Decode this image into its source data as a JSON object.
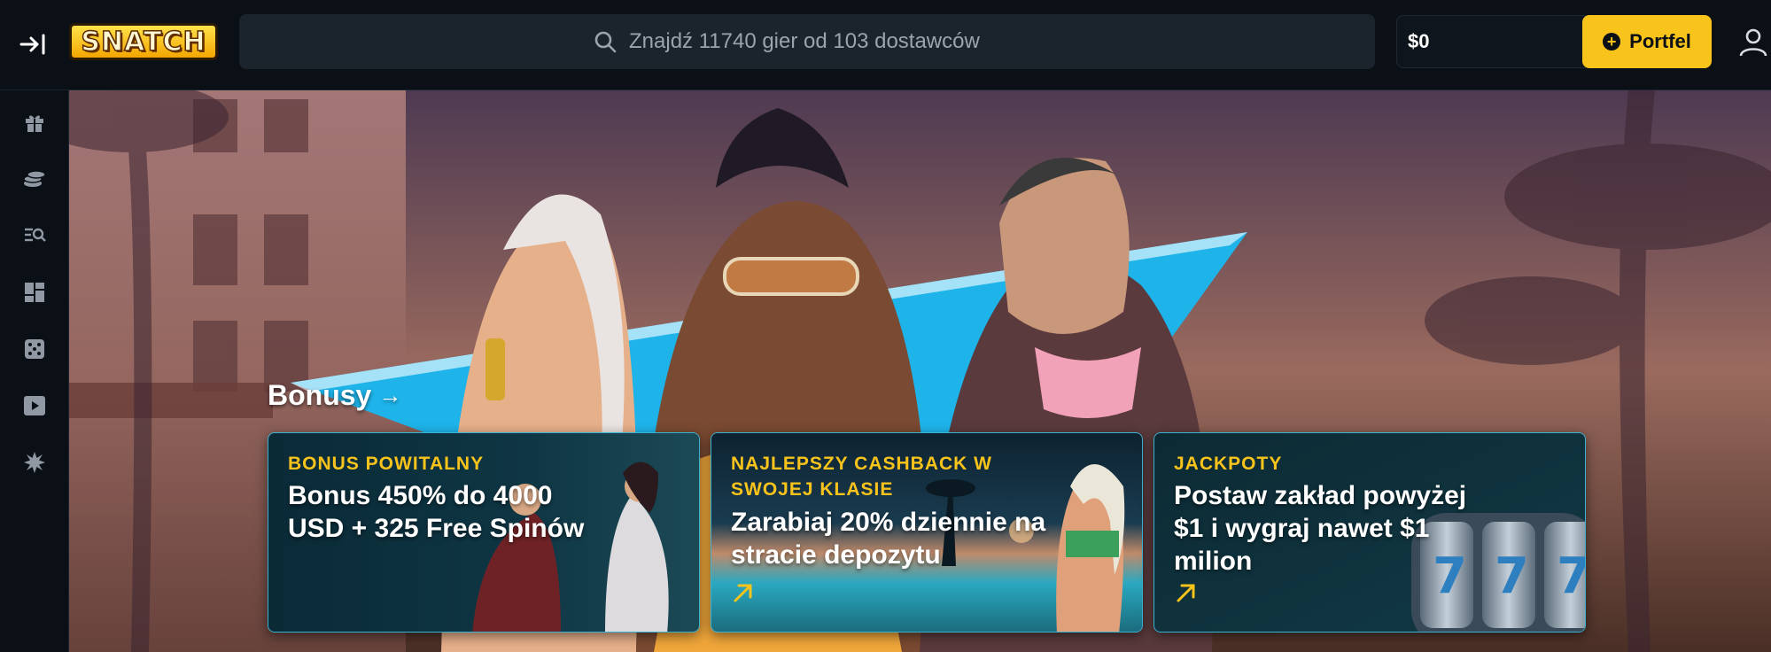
{
  "header": {
    "logo_text": "SNATCH",
    "search_placeholder": "Znajdź 11740 gier od 103 dostawców",
    "balance": "$0",
    "wallet_label": "Portfel"
  },
  "sidebar": {
    "items": [
      {
        "icon": "gift-icon"
      },
      {
        "icon": "coins-icon"
      },
      {
        "icon": "search-list-icon"
      },
      {
        "icon": "dashboard-icon"
      },
      {
        "icon": "dice-icon"
      },
      {
        "icon": "play-icon"
      },
      {
        "icon": "burst-icon"
      }
    ]
  },
  "hero": {
    "section_title": "Bonusy",
    "cards": [
      {
        "tag": "BONUS POWITALNY",
        "text": "Bonus 450% do 4000 USD + 325 Free Spinów"
      },
      {
        "tag": "NAJLEPSZY CASHBACK W SWOJEJ KLASIE",
        "text": "Zarabiaj 20% dziennie na stracie depozytu"
      },
      {
        "tag": "JACKPOTY",
        "text": "Postaw zakład powyżej $1 i wygraj nawet $1 milion"
      }
    ]
  },
  "colors": {
    "accent": "#f8c31b",
    "background": "#0b1016",
    "card_border": "#3bb3d4"
  }
}
